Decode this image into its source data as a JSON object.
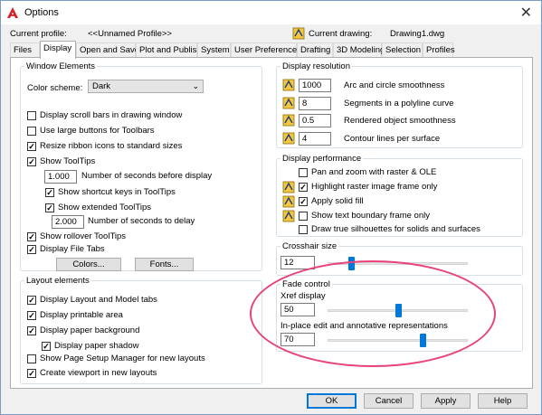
{
  "window": {
    "title": "Options",
    "close_symbol": "✕"
  },
  "profile": {
    "current_profile_label": "Current profile:",
    "current_profile_value": "<<Unnamed Profile>>",
    "current_drawing_label": "Current drawing:",
    "current_drawing_value": "Drawing1.dwg"
  },
  "tabs": [
    "Files",
    "Display",
    "Open and Save",
    "Plot and Publish",
    "System",
    "User Preferences",
    "Drafting",
    "3D Modeling",
    "Selection",
    "Profiles"
  ],
  "window_elements": {
    "legend": "Window Elements",
    "color_scheme_label": "Color scheme:",
    "color_scheme_value": "Dark",
    "display_scroll_bars": "Display scroll bars in drawing window",
    "large_buttons": "Use large buttons for Toolbars",
    "resize_ribbon": "Resize ribbon icons to standard sizes",
    "show_tooltips": "Show ToolTips",
    "seconds_before_display_value": "1.000",
    "seconds_before_display_label": "Number of seconds before display",
    "show_shortcut_keys": "Show shortcut keys in ToolTips",
    "show_extended_tooltips": "Show extended ToolTips",
    "seconds_to_delay_value": "2.000",
    "seconds_to_delay_label": "Number of seconds to delay",
    "show_rollover": "Show rollover ToolTips",
    "display_file_tabs": "Display File Tabs",
    "colors_button": "Colors...",
    "fonts_button": "Fonts..."
  },
  "layout_elements": {
    "legend": "Layout elements",
    "display_layout_model_tabs": "Display Layout and Model tabs",
    "display_printable_area": "Display printable area",
    "display_paper_background": "Display paper background",
    "display_paper_shadow": "Display paper shadow",
    "show_page_setup": "Show Page Setup Manager for new layouts",
    "create_viewport": "Create viewport in new layouts"
  },
  "display_resolution": {
    "legend": "Display resolution",
    "arc_value": "1000",
    "arc_label": "Arc and circle smoothness",
    "segments_value": "8",
    "segments_label": "Segments in a polyline curve",
    "rendered_value": "0.5",
    "rendered_label": "Rendered object smoothness",
    "contour_value": "4",
    "contour_label": "Contour lines per surface"
  },
  "display_performance": {
    "legend": "Display performance",
    "pan_zoom": "Pan and zoom with raster & OLE",
    "highlight_raster": "Highlight raster image frame only",
    "apply_solid_fill": "Apply solid fill",
    "show_text_boundary": "Show text boundary frame only",
    "draw_true_silhouettes": "Draw true silhouettes for solids and surfaces"
  },
  "crosshair": {
    "legend": "Crosshair size",
    "value": "12",
    "fraction": 0.12
  },
  "fade_control": {
    "legend": "Fade control",
    "xref_label": "Xref display",
    "xref_value": "50",
    "xref_fraction": 0.5,
    "inplace_label": "In-place edit and annotative representations",
    "inplace_value": "70",
    "inplace_fraction": 0.7
  },
  "footer": {
    "ok": "OK",
    "cancel": "Cancel",
    "apply": "Apply",
    "help": "Help"
  },
  "colors": {
    "accent": "#0078d7",
    "annotation": "#e8437a",
    "app_icon": "#d71f26"
  }
}
